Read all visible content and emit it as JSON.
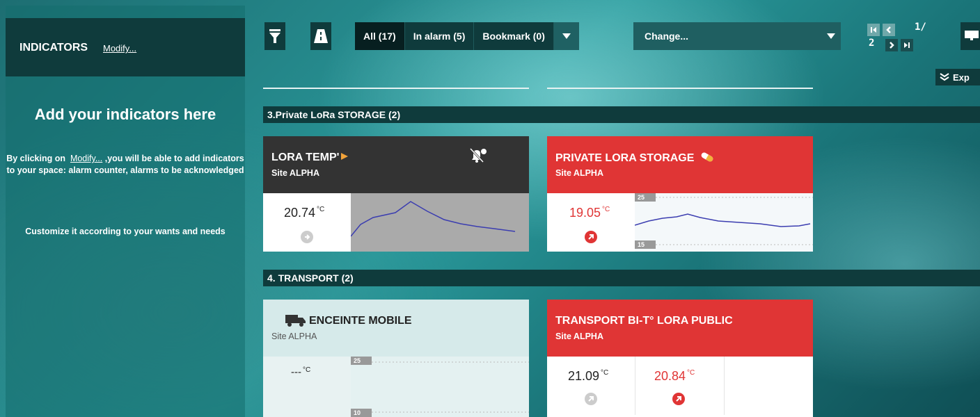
{
  "sidebar": {
    "title": "INDICATORS",
    "modify_link": "Modify...",
    "add_title": "Add your indicators here",
    "description_before": "By clicking on",
    "description_link": "Modify...",
    "description_after": " ,you will be able to add indicators to your space: alarm counter, alarms to be acknowledged",
    "customize": "Customize it according to your wants and needs"
  },
  "toolbar": {
    "filter_icon": "funnel-icon",
    "road_icon": "road-icon",
    "tabs": [
      {
        "label": "All (17)",
        "active": true
      },
      {
        "label": "In alarm (5)",
        "active": false
      },
      {
        "label": "Bookmark (0)",
        "active": false
      }
    ],
    "change_select": "Change...",
    "page_current": "1/",
    "page_total": "2",
    "expand_label": "Exp"
  },
  "sections": [
    {
      "title": "3.Private LoRa STORAGE (2)"
    },
    {
      "title": "4. TRANSPORT (2)"
    }
  ],
  "cards": {
    "lora_temp": {
      "title": "LORA TEMP'",
      "site": "Site ALPHA",
      "value": "20.74",
      "unit": "°C",
      "muted": true
    },
    "private_storage": {
      "title": "PRIVATE LORA STORAGE",
      "site": "Site ALPHA",
      "value": "19.05",
      "unit": "°C",
      "scale_max": "25",
      "scale_min": "15",
      "color": "#e03535"
    },
    "enceinte": {
      "title": "ENCEINTE MOBILE",
      "site": "Site ALPHA",
      "value": "---",
      "unit": "°C",
      "scale_max": "25",
      "scale_min": "10"
    },
    "transport": {
      "title": "TRANSPORT BI-T° LORA PUBLIC",
      "site": "Site ALPHA",
      "value1": "21.09",
      "value2": "20.84",
      "unit": "°C",
      "color": "#e03535"
    }
  }
}
